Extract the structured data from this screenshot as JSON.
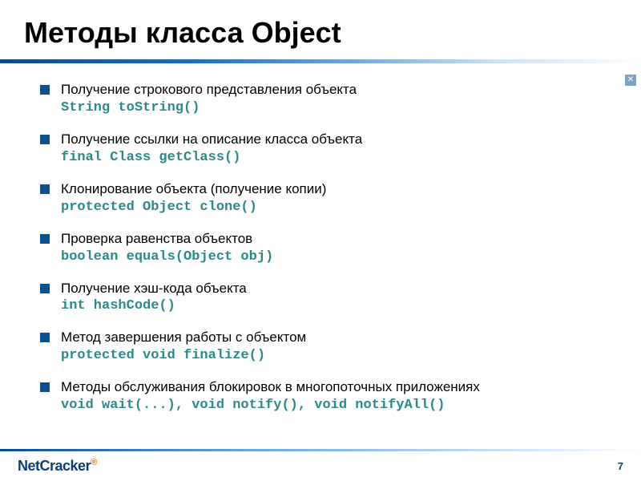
{
  "title": "Методы класса Object",
  "bullets": [
    {
      "desc": "Получение строкового представления объекта",
      "code": "String toString()"
    },
    {
      "desc": "Получение ссылки на описание класса объекта",
      "code": "final Class getClass()"
    },
    {
      "desc": "Клонирование объекта (получение копии)",
      "code": "protected Object clone()"
    },
    {
      "desc": "Проверка равенства объектов",
      "code": "boolean equals(Object obj)"
    },
    {
      "desc": "Получение хэш-кода объекта",
      "code": "int hashCode()"
    },
    {
      "desc": "Метод завершения работы с объектом",
      "code": "protected void finalize()"
    },
    {
      "desc": "Методы обслуживания блокировок в многопоточных приложениях",
      "code": "void wait(...), void notify(), void notifyAll()"
    }
  ],
  "footer": {
    "logo_main": "Net",
    "logo_accent": "Cracker",
    "logo_mark": "®",
    "page": "7"
  },
  "close_glyph": "✕"
}
